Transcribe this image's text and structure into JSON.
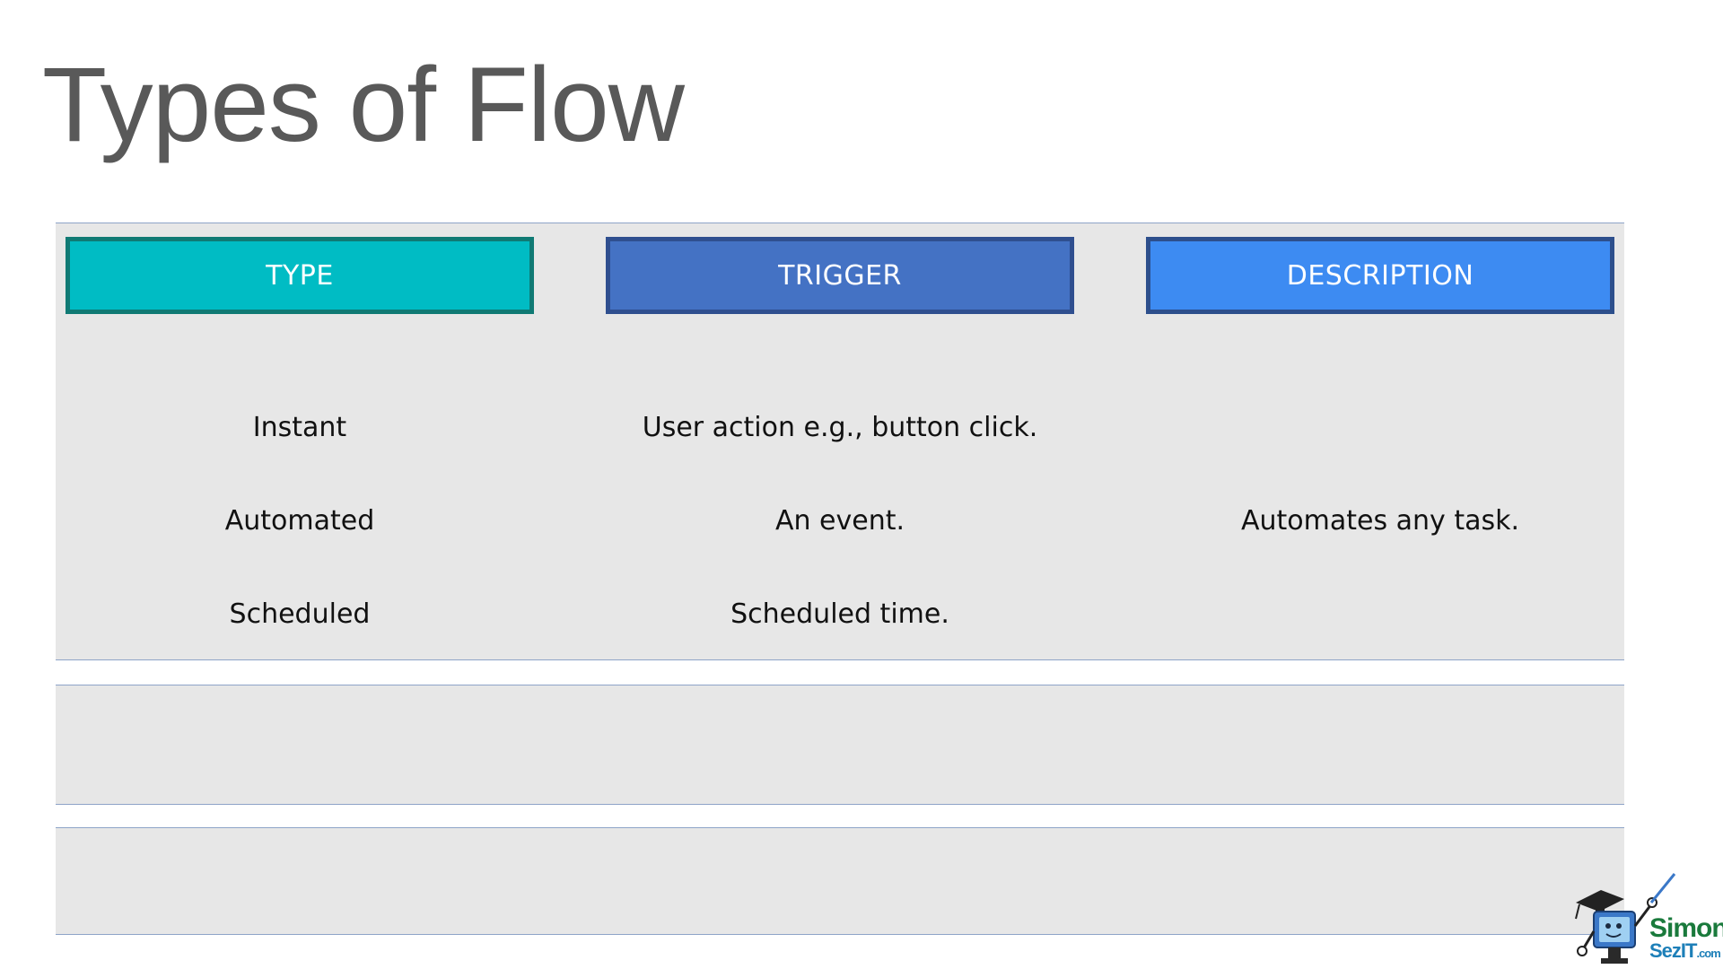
{
  "slide": {
    "title": "Types of Flow"
  },
  "table": {
    "headers": [
      "TYPE",
      "TRIGGER",
      "DESCRIPTION"
    ],
    "header_colors": [
      "#00bcc4",
      "#4472c4",
      "#3d8bf2"
    ],
    "rows": [
      [
        "Instant",
        "User action e.g., button click.",
        ""
      ],
      [
        "Automated",
        "An event.",
        "Automates any task."
      ],
      [
        "Scheduled",
        "Scheduled time.",
        ""
      ]
    ]
  },
  "logo": {
    "line1": "Simon",
    "line2": "SezIT",
    "suffix": ".com",
    "icon": "mascot-computer-graduate-icon"
  }
}
